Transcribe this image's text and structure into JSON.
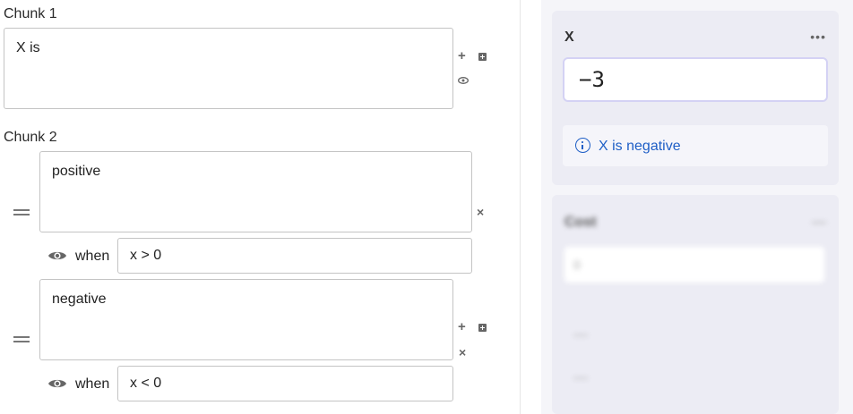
{
  "editor": {
    "chunk1": {
      "title": "Chunk 1",
      "text": "X is"
    },
    "chunk2": {
      "title": "Chunk 2",
      "options": [
        {
          "text": "positive",
          "when_label": "when",
          "condition": "x > 0"
        },
        {
          "text": "negative",
          "when_label": "when",
          "condition": "x < 0"
        }
      ]
    },
    "icons": {
      "add": "+",
      "remove": "×"
    }
  },
  "panel": {
    "variable": {
      "name": "X",
      "value": "−3",
      "menu": "•••",
      "info": "X is negative"
    },
    "blurred_card": {
      "title": "Cost",
      "value": "0",
      "lines": [
        "—",
        "—"
      ],
      "menu": "—"
    }
  },
  "colors": {
    "accent_blue": "#1f5fc6",
    "panel_bg": "#f5f5f9",
    "card_bg": "#ececf4",
    "input_border_focus": "#d4d2f4"
  }
}
